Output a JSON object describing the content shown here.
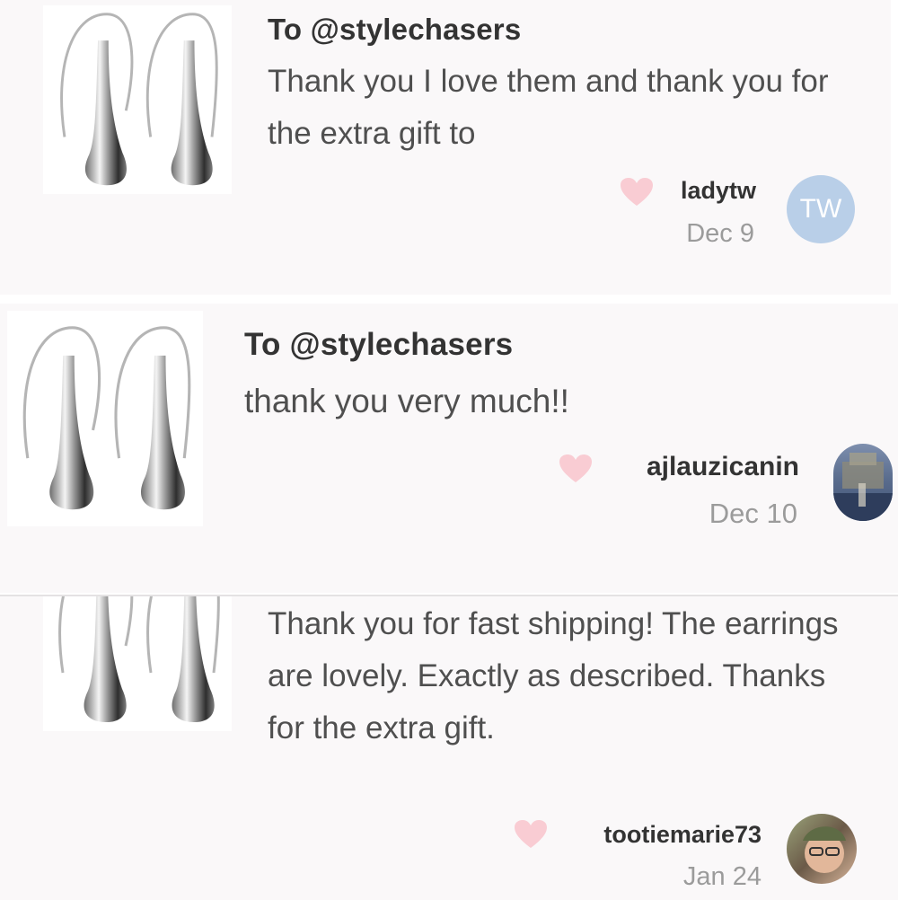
{
  "reviews": [
    {
      "to": "To @stylechasers",
      "message": "Thank you I love them and thank you for the extra gift to",
      "username": "ladytw",
      "date": "Dec 9",
      "avatar_initials": "TW"
    },
    {
      "to": "To @stylechasers",
      "message": "thank you very much!!",
      "username": "ajlauzicanin",
      "date": "Dec 10"
    },
    {
      "message": "Thank you for fast shipping! The earrings are lovely. Exactly as described. Thanks for the extra gift.",
      "username": "tootiemarie73",
      "date": "Jan 24"
    }
  ],
  "icons": {
    "like": "heart-icon",
    "product": "teardrop-earrings-image"
  },
  "colors": {
    "heart": "#f9ccd3",
    "avatar_bg": "#b9cfe8",
    "card_bg": "#faf8f9"
  }
}
